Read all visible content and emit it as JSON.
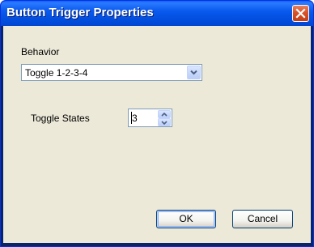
{
  "window": {
    "title": "Button Trigger Properties",
    "close_icon": "close-icon"
  },
  "behavior": {
    "label": "Behavior",
    "selected": "Toggle 1-2-3-4",
    "dropdown_icon": "chevron-down-icon"
  },
  "toggle_states": {
    "label": "Toggle States",
    "value": "3",
    "up_icon": "chevron-up-icon",
    "down_icon": "chevron-down-icon"
  },
  "buttons": {
    "ok": "OK",
    "cancel": "Cancel"
  },
  "colors": {
    "titlebar": "#0350e0",
    "client_bg": "#ece9d8",
    "close_button": "#d9522a",
    "field_border": "#7f9db9"
  }
}
